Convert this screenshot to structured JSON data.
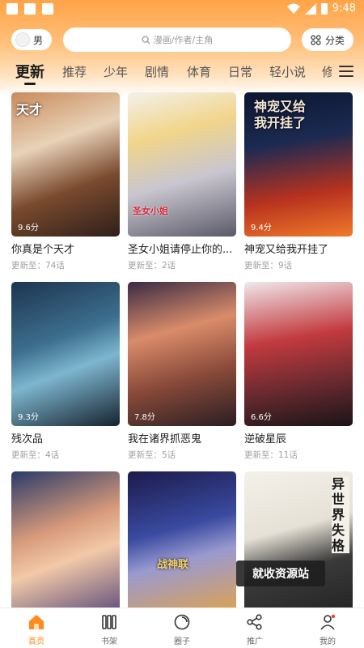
{
  "status_bar": {
    "time": "9:48"
  },
  "gender_toggle": {
    "label": "男"
  },
  "search": {
    "placeholder": "漫画/作者/主角"
  },
  "category_button": {
    "label": "分类"
  },
  "tabs": [
    "更新",
    "推荐",
    "少年",
    "剧情",
    "体育",
    "日常",
    "轻小说",
    "修"
  ],
  "active_tab_index": 0,
  "colors": {
    "accent": "#ff8a1e",
    "header_gradient_top": "#ffa347"
  },
  "comics": [
    {
      "title": "你真是个天才",
      "update_prefix": "更新至：",
      "episodes": "74话",
      "score": "9.6分",
      "cover_text": "天才"
    },
    {
      "title": "圣女小姐请停止你的...",
      "update_prefix": "更新至：",
      "episodes": "2话",
      "score": "",
      "cover_text": "圣女小姐"
    },
    {
      "title": "神宠又给我开挂了",
      "update_prefix": "更新至：",
      "episodes": "9话",
      "score": "9.4分",
      "cover_text": "神宠又给我开挂了"
    },
    {
      "title": "残次品",
      "update_prefix": "更新至：",
      "episodes": "4话",
      "score": "9.3分",
      "cover_text": ""
    },
    {
      "title": "我在诸界抓恶鬼",
      "update_prefix": "更新至：",
      "episodes": "5话",
      "score": "7.8分",
      "cover_text": ""
    },
    {
      "title": "逆破星辰",
      "update_prefix": "更新至：",
      "episodes": "11话",
      "score": "6.6分",
      "cover_text": ""
    },
    {
      "title": "",
      "update_prefix": "",
      "episodes": "",
      "score": "",
      "cover_text": ""
    },
    {
      "title": "",
      "update_prefix": "",
      "episodes": "",
      "score": "",
      "cover_text": "战神联"
    },
    {
      "title": "",
      "update_prefix": "",
      "episodes": "",
      "score": "",
      "cover_text": "异世界失格"
    }
  ],
  "watermark": {
    "text": "就收资源站"
  },
  "bottom_nav": [
    {
      "label": "首页",
      "icon": "home-icon",
      "active": true
    },
    {
      "label": "书架",
      "icon": "bookshelf-icon",
      "active": false
    },
    {
      "label": "圈子",
      "icon": "circle-icon",
      "active": false
    },
    {
      "label": "推广",
      "icon": "share-icon",
      "active": false
    },
    {
      "label": "我的",
      "icon": "profile-icon",
      "active": false
    }
  ]
}
